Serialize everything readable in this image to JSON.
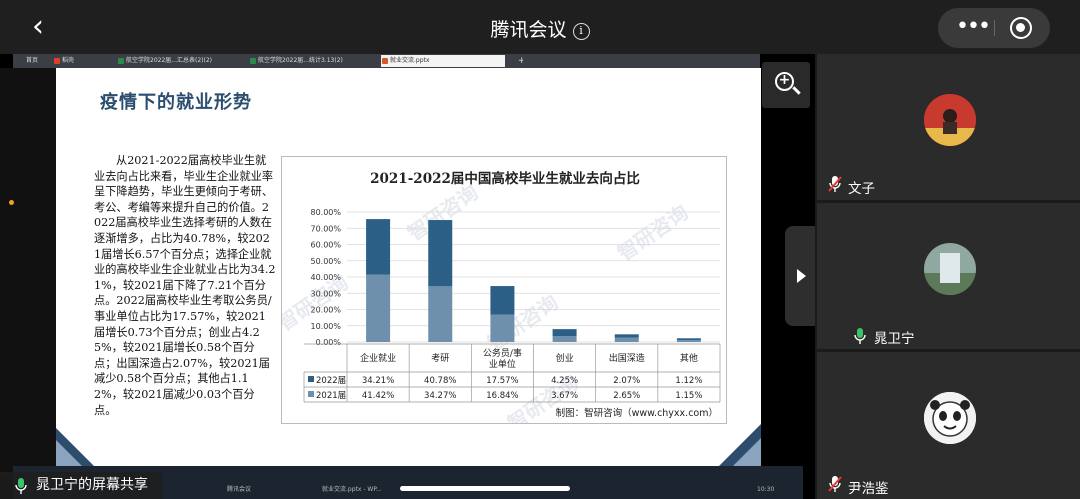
{
  "app": {
    "title": "腾讯会议",
    "info_symbol": "i",
    "back_symbol": "‹"
  },
  "browser_tabs": [
    {
      "label": "首页",
      "color": "#3b3f45"
    },
    {
      "label": "稻壳",
      "color": "#d9412b"
    },
    {
      "label": "航空学院2022届...汇总表(2)(2)",
      "color": "#2a8a4a"
    },
    {
      "label": "航空学院2022届...统计3.13(2)",
      "color": "#2a8a4a"
    },
    {
      "label": "就业交流.pptx",
      "color": "#d9582b"
    }
  ],
  "slide": {
    "title": "疫情下的就业形势",
    "body": "从2021-2022届高校毕业生就业去向占比来看，毕业生企业就业率呈下降趋势，毕业生更倾向于考研、考公、考编等来提升自己的价值。2022届高校毕业生选择考研的人数在逐渐增多，占比为40.78%，较2021届增长6.57个百分点；选择企业就业的高校毕业生企业就业占比为34.21%，较2021届下降了7.21个百分点。2022届高校毕业生考取公务员/事业单位占比为17.57%，较2021届增长0.73个百分点；创业占4.25%，较2021届增长0.58个百分点；出国深造占2.07%，较2021届减少0.58个百分点；其他占1.12%，较2021届减少0.03个百分点。"
  },
  "chart_data": {
    "type": "bar",
    "stacked": true,
    "title": "2021-2022届中国高校毕业生就业去向占比",
    "categories": [
      "企业就业",
      "考研",
      "公务员/事业单位",
      "创业",
      "出国深造",
      "其他"
    ],
    "series": [
      {
        "name": "2022届",
        "values": [
          34.21,
          40.78,
          17.57,
          4.25,
          2.07,
          1.12
        ],
        "labels": [
          "34.21%",
          "40.78%",
          "17.57%",
          "4.25%",
          "2.07%",
          "1.12%"
        ],
        "color": "#2b5f86"
      },
      {
        "name": "2021届",
        "values": [
          41.42,
          34.27,
          16.84,
          3.67,
          2.65,
          1.15
        ],
        "labels": [
          "41.42%",
          "34.27%",
          "16.84%",
          "3.67%",
          "2.65%",
          "1.15%"
        ],
        "color": "#6e90ac"
      }
    ],
    "yticks": [
      "0.00%",
      "10.00%",
      "20.00%",
      "30.00%",
      "40.00%",
      "50.00%",
      "60.00%",
      "70.00%",
      "80.00%"
    ],
    "ylim": [
      0,
      80
    ],
    "grid": true,
    "legend": "data-table",
    "source": "制图：智研咨询（www.chyxx.com）",
    "watermark": "智研咨询"
  },
  "share": {
    "label": "晁卫宁的屏幕共享"
  },
  "taskbar": [
    "腾讯会议",
    "就业交流.pptx - WP...",
    "10:30"
  ],
  "participants": [
    {
      "name": "文子",
      "muted": true
    },
    {
      "name": "晁卫宁",
      "muted": false,
      "host": true
    },
    {
      "name": "尹浩鉴",
      "muted": true
    }
  ]
}
